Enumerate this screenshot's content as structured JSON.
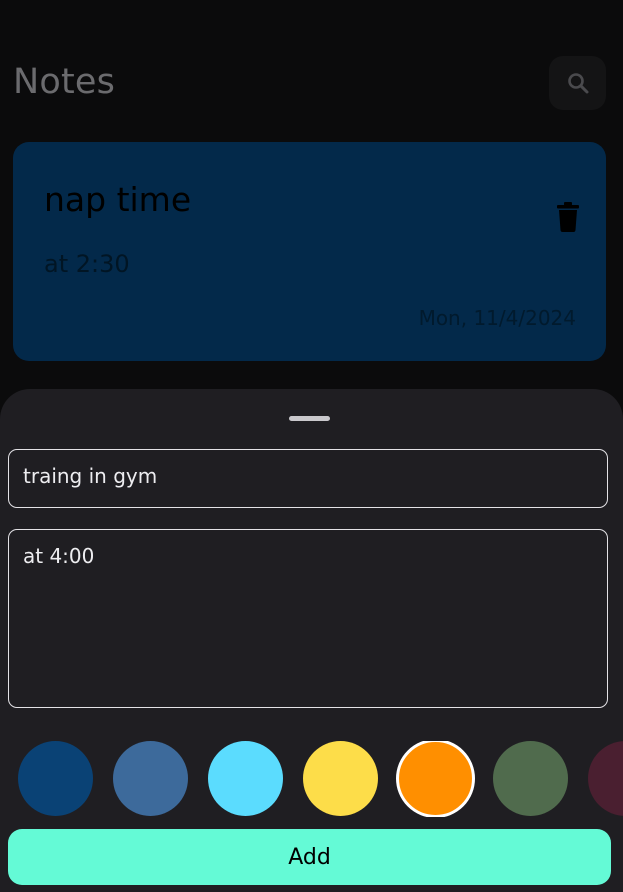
{
  "header": {
    "title": "Notes",
    "search_icon": "search-icon"
  },
  "notes": [
    {
      "title": "nap time",
      "body": "at 2:30",
      "date": "Mon, 11/4/2024",
      "color": "#03294a"
    }
  ],
  "sheet": {
    "title_value": "traing in gym",
    "body_value": "at 4:00",
    "colors": [
      "#0a4275",
      "#3d6a9b",
      "#5bdcfe",
      "#fddd49",
      "#ff8f00",
      "#506b4d",
      "#4a1f30"
    ],
    "selected_color": "#ff8f00",
    "add_label": "Add"
  }
}
